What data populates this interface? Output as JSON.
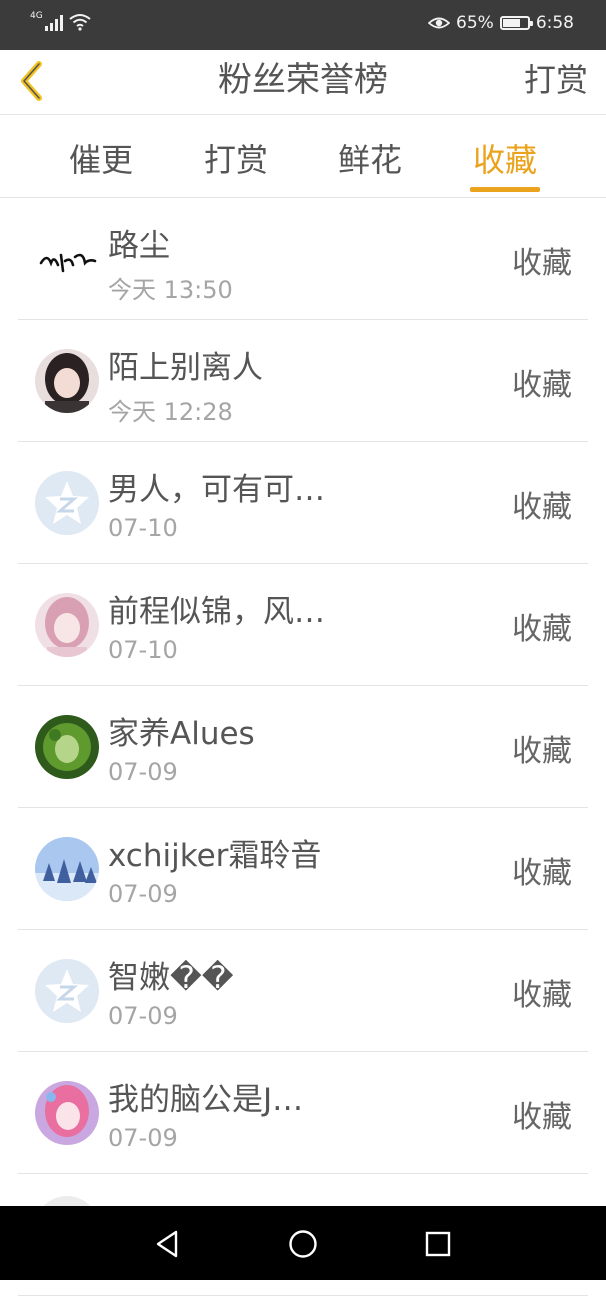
{
  "status_bar": {
    "network": "4G",
    "battery_percent": "65%",
    "time": "6:58"
  },
  "header": {
    "back_icon": "chevron-left-icon",
    "title": "粉丝荣誉榜",
    "right_action": "打赏"
  },
  "tabs": [
    {
      "label": "催更",
      "active": false
    },
    {
      "label": "打赏",
      "active": false
    },
    {
      "label": "鲜花",
      "active": false
    },
    {
      "label": "收藏",
      "active": true
    }
  ],
  "accent_color": "#eba21c",
  "list": [
    {
      "name": "路尘",
      "time": "今天 13:50",
      "action": "收藏",
      "avatar": "calligraphy"
    },
    {
      "name": "陌上别离人",
      "time": "今天 12:28",
      "action": "收藏",
      "avatar": "girl-dark-hair"
    },
    {
      "name": "男人，可有可…",
      "time": "07-10",
      "action": "收藏",
      "avatar": "default-qq"
    },
    {
      "name": "前程似锦，风…",
      "time": "07-10",
      "action": "收藏",
      "avatar": "girl-pink"
    },
    {
      "name": "家养Alues",
      "time": "07-09",
      "action": "收藏",
      "avatar": "green-portrait"
    },
    {
      "name": "xchijker霜聆音",
      "time": "07-09",
      "action": "收藏",
      "avatar": "snow-forest"
    },
    {
      "name": "智嫩��",
      "time": "07-09",
      "action": "收藏",
      "avatar": "default-qq"
    },
    {
      "name": "我的脑公是J…",
      "time": "07-09",
      "action": "收藏",
      "avatar": "girl-pink-purple"
    },
    {
      "name": "",
      "time": "",
      "action": "",
      "avatar": "partial"
    }
  ],
  "nav_bar": {
    "back": "triangle-back-icon",
    "home": "circle-home-icon",
    "recents": "square-recents-icon"
  }
}
